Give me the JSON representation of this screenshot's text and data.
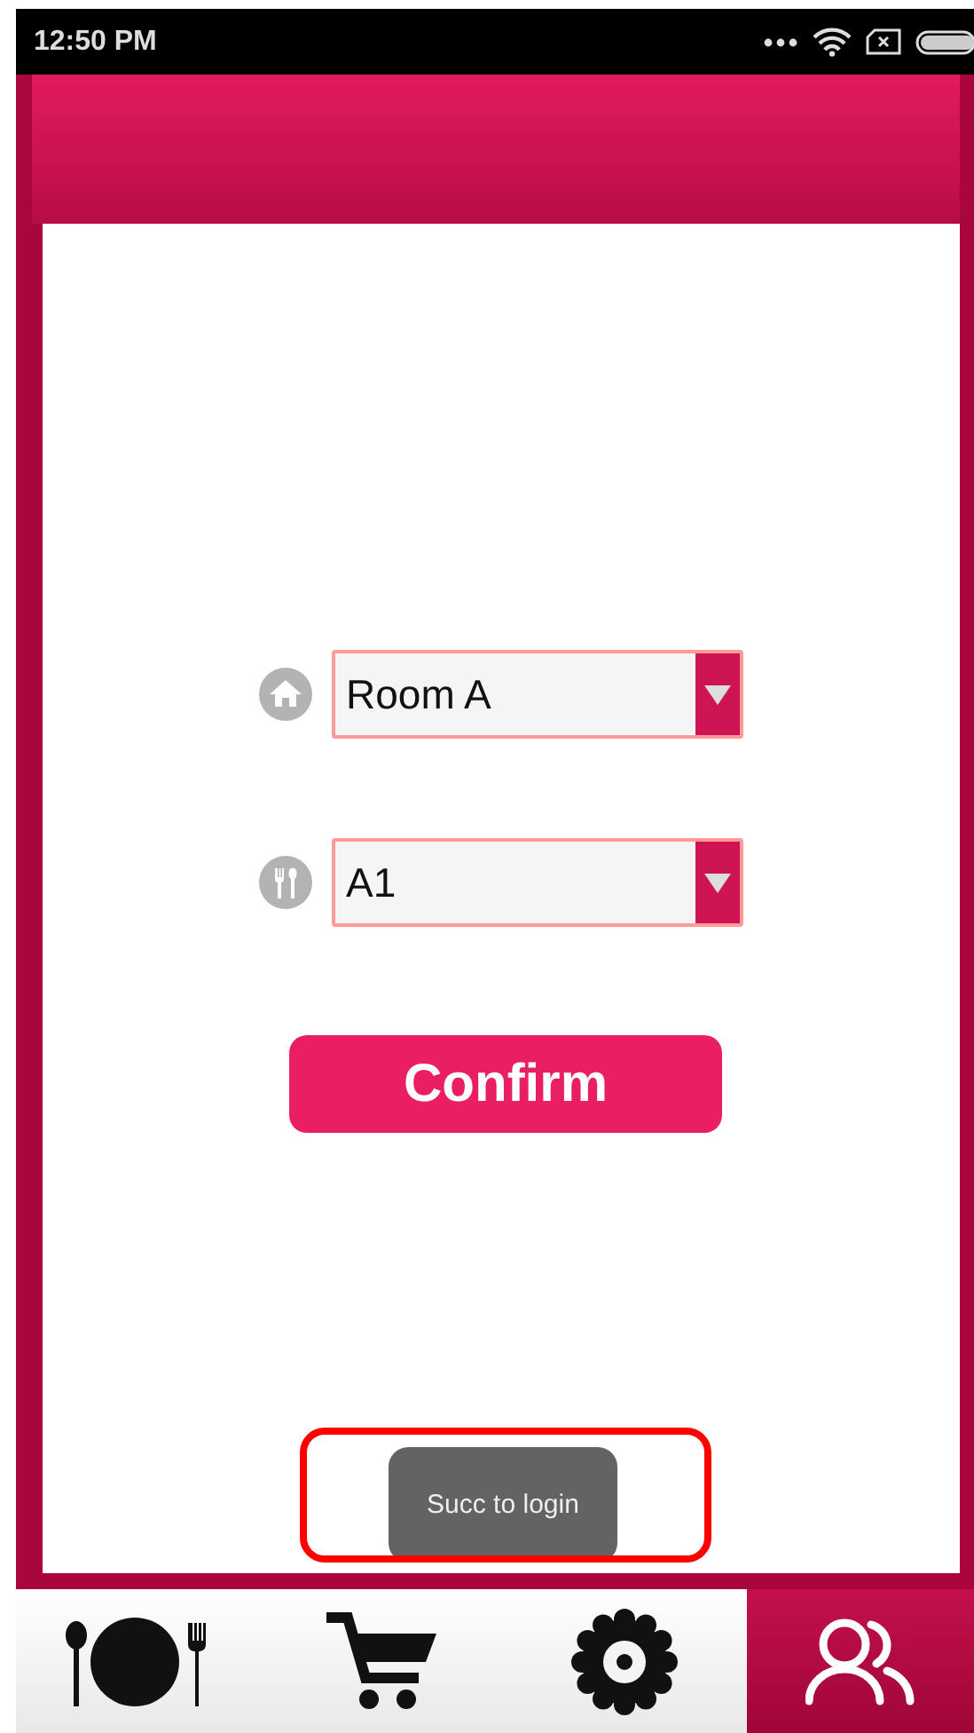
{
  "status_bar": {
    "time": "12:50 PM"
  },
  "selects": [
    {
      "kind": "room",
      "value": "Room A"
    },
    {
      "kind": "table",
      "value": "A1"
    }
  ],
  "confirm_button": {
    "label": "Confirm"
  },
  "toast": {
    "text": "Succ to login",
    "highlighted": true
  },
  "tabs": [
    {
      "kind": "dining",
      "selected": false
    },
    {
      "kind": "cart",
      "selected": false
    },
    {
      "kind": "settings",
      "selected": false
    },
    {
      "kind": "users",
      "selected": true
    }
  ]
}
